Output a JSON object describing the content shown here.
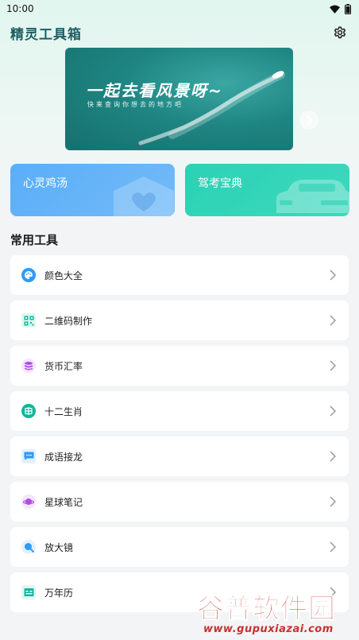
{
  "status_bar": {
    "time": "10:00"
  },
  "app_bar": {
    "title": "精灵工具箱",
    "settings_icon": "gear-icon"
  },
  "banner": {
    "headline": "一起去看风景呀~",
    "subtitle": "快来查询你想去的地方吧"
  },
  "feature_cards": [
    {
      "label": "心灵鸡汤",
      "color": "#5aaef9",
      "icon": "house-heart-icon"
    },
    {
      "label": "驾考宝典",
      "color": "#2bd2b4",
      "icon": "car-icon"
    }
  ],
  "section": {
    "title": "常用工具"
  },
  "tools": [
    {
      "label": "颜色大全",
      "icon": "palette-icon",
      "color": "#2f9bf3",
      "bg": "#e3f1fd"
    },
    {
      "label": "二维码制作",
      "icon": "qr-code-icon",
      "color": "#13b59b",
      "bg": "#e1f6f1"
    },
    {
      "label": "货币汇率",
      "icon": "coins-icon",
      "color": "#b04fe0",
      "bg": "#f3e5fb"
    },
    {
      "label": "十二生肖",
      "icon": "zodiac-icon",
      "color": "#13b59b",
      "bg": "#e1f6f1"
    },
    {
      "label": "成语接龙",
      "icon": "chat-icon",
      "color": "#2f9bf3",
      "bg": "#e3f1fd"
    },
    {
      "label": "星球笔记",
      "icon": "planet-icon",
      "color": "#b04fe0",
      "bg": "#f3e5fb"
    },
    {
      "label": "放大镜",
      "icon": "magnifier-icon",
      "color": "#2f9bf3",
      "bg": "#e3f1fd"
    },
    {
      "label": "万年历",
      "icon": "calendar-icon",
      "color": "#13b59b",
      "bg": "#e1f6f1"
    }
  ],
  "watermark": {
    "brand": "谷普软件园",
    "url": "www.gupuxiazai.com"
  }
}
